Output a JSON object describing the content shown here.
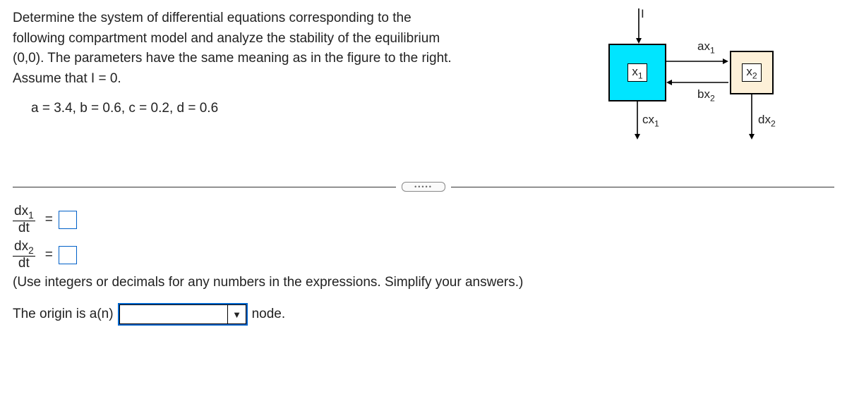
{
  "problem": {
    "line1": "Determine the system of differential equations corresponding to the",
    "line2": "following compartment model and analyze the stability of the equilibrium",
    "line3": "(0,0). The parameters have the same meaning as in the figure to the right.",
    "assume_line": "Assume that I = 0.",
    "params_line": "a = 3.4, b = 0.6, c = 0.2, d = 0.6"
  },
  "diagram": {
    "input_label": "I",
    "box1_label": "x1",
    "box2_label": "x2",
    "ax1_label": "ax1",
    "bx2_label": "bx2",
    "cx1_label": "cx1",
    "dx2_label": "dx2"
  },
  "equations": {
    "dx1_num": "dx1",
    "dx2_num": "dx2",
    "dt": "dt",
    "equals": "="
  },
  "hint": "(Use integers or decimals for any numbers in the expressions. Simplify your answers.)",
  "origin": {
    "prefix": "The origin is a(n)",
    "suffix": "node."
  }
}
